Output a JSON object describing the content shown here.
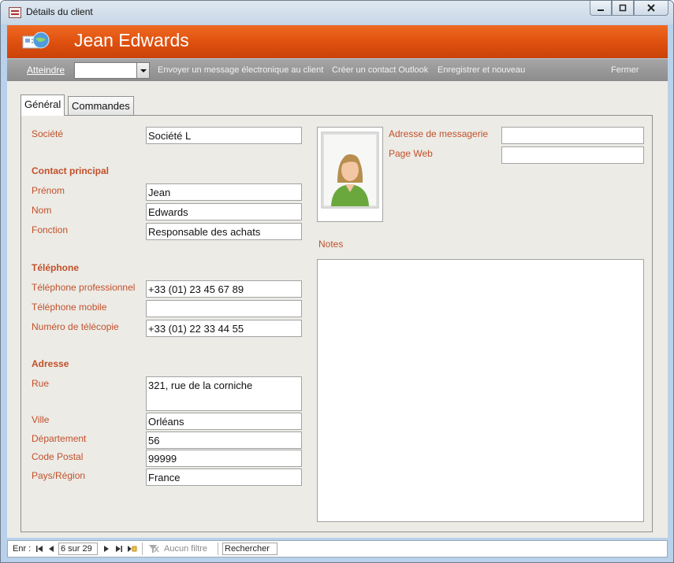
{
  "window": {
    "title": "Détails du client"
  },
  "header": {
    "name": "Jean Edwards"
  },
  "toolbar": {
    "goto_label": "Atteindre",
    "goto_value": "",
    "email_link": "Envoyer un message électronique au client",
    "outlook_link": "Créer un contact Outlook",
    "save_new_link": "Enregistrer et nouveau",
    "close_link": "Fermer"
  },
  "tabs": [
    "Général",
    "Commandes"
  ],
  "form": {
    "company_label": "Société",
    "company_value": "Société L",
    "contact_section": "Contact principal",
    "first_name_label": "Prénom",
    "first_name_value": "Jean",
    "last_name_label": "Nom",
    "last_name_value": "Edwards",
    "job_label": "Fonction",
    "job_value": "Responsable des achats",
    "phone_section": "Téléphone",
    "work_phone_label": "Téléphone professionnel",
    "work_phone_value": "+33 (01) 23 45 67 89",
    "mobile_label": "Téléphone mobile",
    "mobile_value": "",
    "fax_label": "Numéro de télécopie",
    "fax_value": "+33 (01) 22 33 44 55",
    "address_section": "Adresse",
    "street_label": "Rue",
    "street_value": "321, rue de la corniche",
    "city_label": "Ville",
    "city_value": "Orléans",
    "dept_label": "Département",
    "dept_value": "56",
    "zip_label": "Code Postal",
    "zip_value": "99999",
    "country_label": "Pays/Région",
    "country_value": "France",
    "email_label": "Adresse de messagerie",
    "email_value": "",
    "web_label": "Page Web",
    "web_value": "",
    "notes_label": "Notes",
    "notes_value": ""
  },
  "statusbar": {
    "record_label": "Enr :",
    "record_position": "6 sur 29",
    "filter_label": "Aucun filtre",
    "search_label": "Rechercher"
  },
  "colors": {
    "accent": "#e05a1a",
    "label": "#c2502a"
  },
  "icons": [
    "app-form-icon",
    "contacts-globe-icon",
    "person-photo-icon",
    "first-record-icon",
    "prev-record-icon",
    "next-record-icon",
    "last-record-icon",
    "new-record-icon",
    "filter-icon"
  ]
}
